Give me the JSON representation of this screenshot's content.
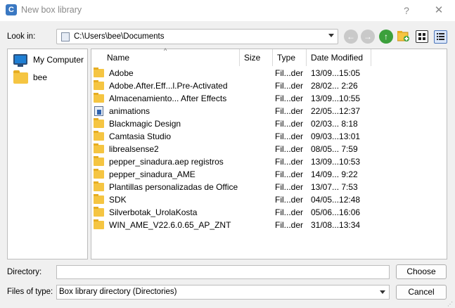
{
  "window": {
    "title": "New box library",
    "app_icon_letter": "C",
    "help_label": "?",
    "close_label": "✕"
  },
  "lookin": {
    "label": "Look in:",
    "path": "C:\\Users\\bee\\Documents"
  },
  "toolbar": {
    "back_glyph": "←",
    "forward_glyph": "→",
    "up_glyph": "↑"
  },
  "sidebar": {
    "items": [
      {
        "label": "My Computer",
        "icon": "computer-icon"
      },
      {
        "label": "bee",
        "icon": "folder-icon"
      }
    ]
  },
  "files": {
    "columns": [
      "Name",
      "Size",
      "Type",
      "Date Modified"
    ],
    "sort_indicator": "^",
    "rows": [
      {
        "name": "Adobe",
        "size": "",
        "type": "Fil...der",
        "date": "13/09...15:05",
        "icon": "folder-icon"
      },
      {
        "name": "Adobe.After.Eff...l.Pre-Activated",
        "size": "",
        "type": "Fil...der",
        "date": "28/02... 2:26",
        "icon": "folder-icon"
      },
      {
        "name": "Almacenamiento... After Effects",
        "size": "",
        "type": "Fil...der",
        "date": "13/09...10:55",
        "icon": "folder-icon"
      },
      {
        "name": "animations",
        "size": "",
        "type": "Fil...der",
        "date": "22/05...12:37",
        "icon": "special-folder-icon"
      },
      {
        "name": "Blackmagic Design",
        "size": "",
        "type": "Fil...der",
        "date": "02/03... 8:18",
        "icon": "folder-icon"
      },
      {
        "name": "Camtasia Studio",
        "size": "",
        "type": "Fil...der",
        "date": "09/03...13:01",
        "icon": "folder-icon"
      },
      {
        "name": "librealsense2",
        "size": "",
        "type": "Fil...der",
        "date": "08/05... 7:59",
        "icon": "folder-icon"
      },
      {
        "name": "pepper_sinadura.aep registros",
        "size": "",
        "type": "Fil...der",
        "date": "13/09...10:53",
        "icon": "folder-icon"
      },
      {
        "name": "pepper_sinadura_AME",
        "size": "",
        "type": "Fil...der",
        "date": "14/09... 9:22",
        "icon": "folder-icon"
      },
      {
        "name": "Plantillas personalizadas de Office",
        "size": "",
        "type": "Fil...der",
        "date": "13/07... 7:53",
        "icon": "folder-icon"
      },
      {
        "name": "SDK",
        "size": "",
        "type": "Fil...der",
        "date": "04/05...12:48",
        "icon": "folder-icon"
      },
      {
        "name": "Silverbotak_UrolaKosta",
        "size": "",
        "type": "Fil...der",
        "date": "05/06...16:06",
        "icon": "folder-icon"
      },
      {
        "name": "WIN_AME_V22.6.0.65_AP_ZNT",
        "size": "",
        "type": "Fil...der",
        "date": "31/08...13:34",
        "icon": "folder-icon"
      }
    ]
  },
  "bottom": {
    "directory_label": "Directory:",
    "directory_value": "",
    "choose_label": "Choose",
    "type_label": "Files of type:",
    "type_value": "Box library directory (Directories)",
    "cancel_label": "Cancel"
  }
}
